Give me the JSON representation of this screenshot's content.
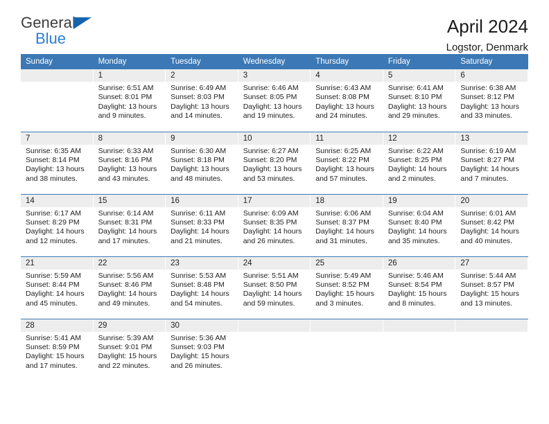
{
  "brand": {
    "name_top": "General",
    "name_bottom": "Blue",
    "accent_color": "#2a7fd4",
    "triangle_color": "#1565ad"
  },
  "header": {
    "title": "April 2024",
    "location": "Logstor, Denmark"
  },
  "theme": {
    "header_bar_color": "#3b78b5",
    "daynum_band_color": "#ededed",
    "row_divider_color": "#3b78b5"
  },
  "weekday_headers": [
    "Sunday",
    "Monday",
    "Tuesday",
    "Wednesday",
    "Thursday",
    "Friday",
    "Saturday"
  ],
  "weeks": [
    [
      {
        "day": "",
        "sunrise": "",
        "sunset": "",
        "daylight1": "",
        "daylight2": ""
      },
      {
        "day": "1",
        "sunrise": "Sunrise: 6:51 AM",
        "sunset": "Sunset: 8:01 PM",
        "daylight1": "Daylight: 13 hours",
        "daylight2": "and 9 minutes."
      },
      {
        "day": "2",
        "sunrise": "Sunrise: 6:49 AM",
        "sunset": "Sunset: 8:03 PM",
        "daylight1": "Daylight: 13 hours",
        "daylight2": "and 14 minutes."
      },
      {
        "day": "3",
        "sunrise": "Sunrise: 6:46 AM",
        "sunset": "Sunset: 8:05 PM",
        "daylight1": "Daylight: 13 hours",
        "daylight2": "and 19 minutes."
      },
      {
        "day": "4",
        "sunrise": "Sunrise: 6:43 AM",
        "sunset": "Sunset: 8:08 PM",
        "daylight1": "Daylight: 13 hours",
        "daylight2": "and 24 minutes."
      },
      {
        "day": "5",
        "sunrise": "Sunrise: 6:41 AM",
        "sunset": "Sunset: 8:10 PM",
        "daylight1": "Daylight: 13 hours",
        "daylight2": "and 29 minutes."
      },
      {
        "day": "6",
        "sunrise": "Sunrise: 6:38 AM",
        "sunset": "Sunset: 8:12 PM",
        "daylight1": "Daylight: 13 hours",
        "daylight2": "and 33 minutes."
      }
    ],
    [
      {
        "day": "7",
        "sunrise": "Sunrise: 6:35 AM",
        "sunset": "Sunset: 8:14 PM",
        "daylight1": "Daylight: 13 hours",
        "daylight2": "and 38 minutes."
      },
      {
        "day": "8",
        "sunrise": "Sunrise: 6:33 AM",
        "sunset": "Sunset: 8:16 PM",
        "daylight1": "Daylight: 13 hours",
        "daylight2": "and 43 minutes."
      },
      {
        "day": "9",
        "sunrise": "Sunrise: 6:30 AM",
        "sunset": "Sunset: 8:18 PM",
        "daylight1": "Daylight: 13 hours",
        "daylight2": "and 48 minutes."
      },
      {
        "day": "10",
        "sunrise": "Sunrise: 6:27 AM",
        "sunset": "Sunset: 8:20 PM",
        "daylight1": "Daylight: 13 hours",
        "daylight2": "and 53 minutes."
      },
      {
        "day": "11",
        "sunrise": "Sunrise: 6:25 AM",
        "sunset": "Sunset: 8:22 PM",
        "daylight1": "Daylight: 13 hours",
        "daylight2": "and 57 minutes."
      },
      {
        "day": "12",
        "sunrise": "Sunrise: 6:22 AM",
        "sunset": "Sunset: 8:25 PM",
        "daylight1": "Daylight: 14 hours",
        "daylight2": "and 2 minutes."
      },
      {
        "day": "13",
        "sunrise": "Sunrise: 6:19 AM",
        "sunset": "Sunset: 8:27 PM",
        "daylight1": "Daylight: 14 hours",
        "daylight2": "and 7 minutes."
      }
    ],
    [
      {
        "day": "14",
        "sunrise": "Sunrise: 6:17 AM",
        "sunset": "Sunset: 8:29 PM",
        "daylight1": "Daylight: 14 hours",
        "daylight2": "and 12 minutes."
      },
      {
        "day": "15",
        "sunrise": "Sunrise: 6:14 AM",
        "sunset": "Sunset: 8:31 PM",
        "daylight1": "Daylight: 14 hours",
        "daylight2": "and 17 minutes."
      },
      {
        "day": "16",
        "sunrise": "Sunrise: 6:11 AM",
        "sunset": "Sunset: 8:33 PM",
        "daylight1": "Daylight: 14 hours",
        "daylight2": "and 21 minutes."
      },
      {
        "day": "17",
        "sunrise": "Sunrise: 6:09 AM",
        "sunset": "Sunset: 8:35 PM",
        "daylight1": "Daylight: 14 hours",
        "daylight2": "and 26 minutes."
      },
      {
        "day": "18",
        "sunrise": "Sunrise: 6:06 AM",
        "sunset": "Sunset: 8:37 PM",
        "daylight1": "Daylight: 14 hours",
        "daylight2": "and 31 minutes."
      },
      {
        "day": "19",
        "sunrise": "Sunrise: 6:04 AM",
        "sunset": "Sunset: 8:40 PM",
        "daylight1": "Daylight: 14 hours",
        "daylight2": "and 35 minutes."
      },
      {
        "day": "20",
        "sunrise": "Sunrise: 6:01 AM",
        "sunset": "Sunset: 8:42 PM",
        "daylight1": "Daylight: 14 hours",
        "daylight2": "and 40 minutes."
      }
    ],
    [
      {
        "day": "21",
        "sunrise": "Sunrise: 5:59 AM",
        "sunset": "Sunset: 8:44 PM",
        "daylight1": "Daylight: 14 hours",
        "daylight2": "and 45 minutes."
      },
      {
        "day": "22",
        "sunrise": "Sunrise: 5:56 AM",
        "sunset": "Sunset: 8:46 PM",
        "daylight1": "Daylight: 14 hours",
        "daylight2": "and 49 minutes."
      },
      {
        "day": "23",
        "sunrise": "Sunrise: 5:53 AM",
        "sunset": "Sunset: 8:48 PM",
        "daylight1": "Daylight: 14 hours",
        "daylight2": "and 54 minutes."
      },
      {
        "day": "24",
        "sunrise": "Sunrise: 5:51 AM",
        "sunset": "Sunset: 8:50 PM",
        "daylight1": "Daylight: 14 hours",
        "daylight2": "and 59 minutes."
      },
      {
        "day": "25",
        "sunrise": "Sunrise: 5:49 AM",
        "sunset": "Sunset: 8:52 PM",
        "daylight1": "Daylight: 15 hours",
        "daylight2": "and 3 minutes."
      },
      {
        "day": "26",
        "sunrise": "Sunrise: 5:46 AM",
        "sunset": "Sunset: 8:54 PM",
        "daylight1": "Daylight: 15 hours",
        "daylight2": "and 8 minutes."
      },
      {
        "day": "27",
        "sunrise": "Sunrise: 5:44 AM",
        "sunset": "Sunset: 8:57 PM",
        "daylight1": "Daylight: 15 hours",
        "daylight2": "and 13 minutes."
      }
    ],
    [
      {
        "day": "28",
        "sunrise": "Sunrise: 5:41 AM",
        "sunset": "Sunset: 8:59 PM",
        "daylight1": "Daylight: 15 hours",
        "daylight2": "and 17 minutes."
      },
      {
        "day": "29",
        "sunrise": "Sunrise: 5:39 AM",
        "sunset": "Sunset: 9:01 PM",
        "daylight1": "Daylight: 15 hours",
        "daylight2": "and 22 minutes."
      },
      {
        "day": "30",
        "sunrise": "Sunrise: 5:36 AM",
        "sunset": "Sunset: 9:03 PM",
        "daylight1": "Daylight: 15 hours",
        "daylight2": "and 26 minutes."
      },
      {
        "day": "",
        "sunrise": "",
        "sunset": "",
        "daylight1": "",
        "daylight2": ""
      },
      {
        "day": "",
        "sunrise": "",
        "sunset": "",
        "daylight1": "",
        "daylight2": ""
      },
      {
        "day": "",
        "sunrise": "",
        "sunset": "",
        "daylight1": "",
        "daylight2": ""
      },
      {
        "day": "",
        "sunrise": "",
        "sunset": "",
        "daylight1": "",
        "daylight2": ""
      }
    ]
  ]
}
